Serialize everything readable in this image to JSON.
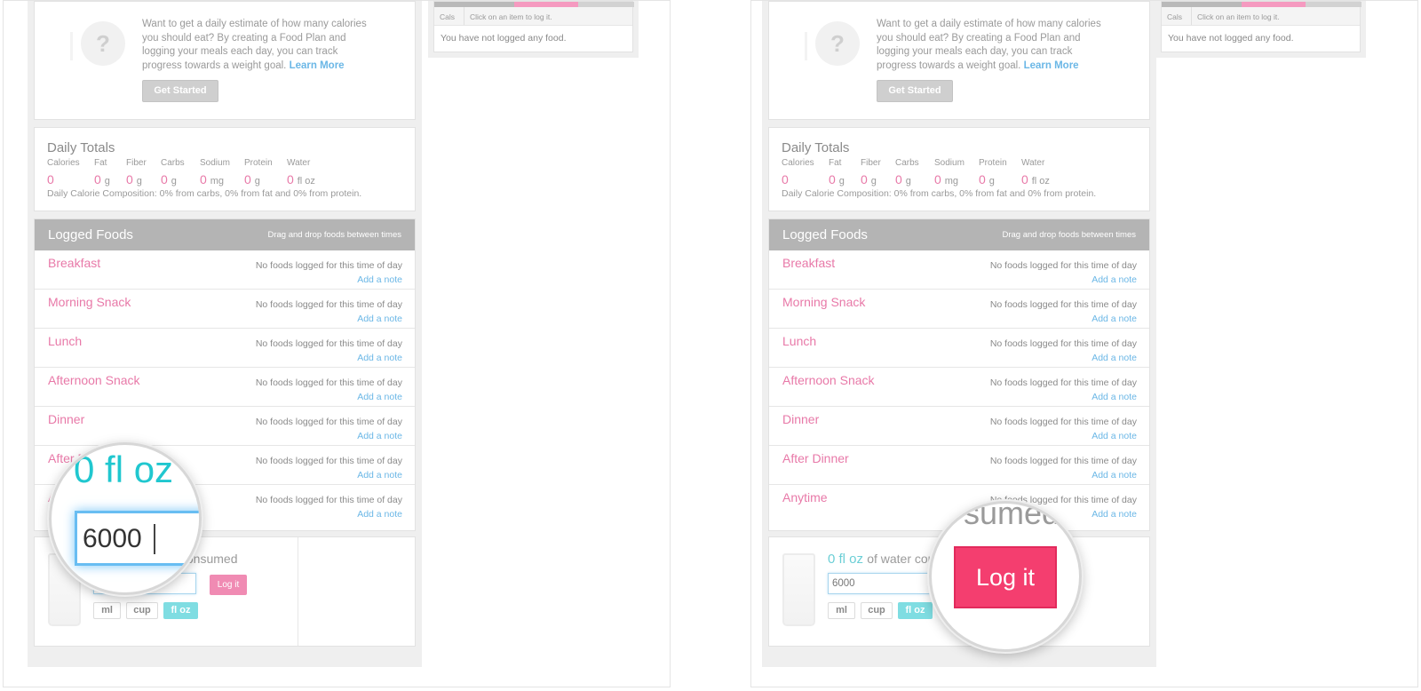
{
  "food_plan": {
    "description": "Want to get a daily estimate of how many calories you should eat? By creating a Food Plan and logging your meals each day, you can track progress towards a weight goal.",
    "learn_more": "Learn More",
    "get_started": "Get Started",
    "placeholder_icon": "question-mark-icon"
  },
  "daily_totals": {
    "title": "Daily Totals",
    "nutrients": [
      {
        "label": "Calories",
        "value": "0",
        "unit": ""
      },
      {
        "label": "Fat",
        "value": "0",
        "unit": "g"
      },
      {
        "label": "Fiber",
        "value": "0",
        "unit": "g"
      },
      {
        "label": "Carbs",
        "value": "0",
        "unit": "g"
      },
      {
        "label": "Sodium",
        "value": "0",
        "unit": "mg"
      },
      {
        "label": "Protein",
        "value": "0",
        "unit": "g"
      },
      {
        "label": "Water",
        "value": "0",
        "unit": "fl oz"
      }
    ],
    "composition": "Daily Calorie Composition: 0% from carbs, 0% from fat and 0% from protein."
  },
  "logged_foods": {
    "title": "Logged Foods",
    "hint": "Drag and drop foods between times",
    "meals": [
      {
        "name": "Breakfast",
        "status": "No foods logged for this time of day",
        "note": "Add a note"
      },
      {
        "name": "Morning Snack",
        "status": "No foods logged for this time of day",
        "note": "Add a note"
      },
      {
        "name": "Lunch",
        "status": "No foods logged for this time of day",
        "note": "Add a note"
      },
      {
        "name": "Afternoon Snack",
        "status": "No foods logged for this time of day",
        "note": "Add a note"
      },
      {
        "name": "Dinner",
        "status": "No foods logged for this time of day",
        "note": "Add a note"
      },
      {
        "name": "After Dinner",
        "status": "No foods logged for this time of day",
        "note": "Add a note"
      },
      {
        "name": "Anytime",
        "status": "No foods logged for this time of day",
        "note": "Add a note"
      }
    ]
  },
  "water": {
    "amount": "0 fl oz",
    "consumed_text": "of water consumed",
    "input_value": "6000",
    "log_button": "Log it",
    "units": [
      "ml",
      "cup",
      "fl oz"
    ],
    "selected_unit": "fl oz"
  },
  "recent": {
    "col_cals": "Cals",
    "col_hint": "Click on an item to log it.",
    "empty": "You have not logged any food."
  },
  "magnifier_left": {
    "amount": "0 fl oz",
    "input_value": "6000"
  },
  "magnifier_right": {
    "text_fragment": "sumed",
    "button": "Log it"
  },
  "colors": {
    "pink": "#e879a8",
    "link_blue": "#6bb7e6",
    "teal": "#20c7cf",
    "log_button": "#f43e6f"
  }
}
